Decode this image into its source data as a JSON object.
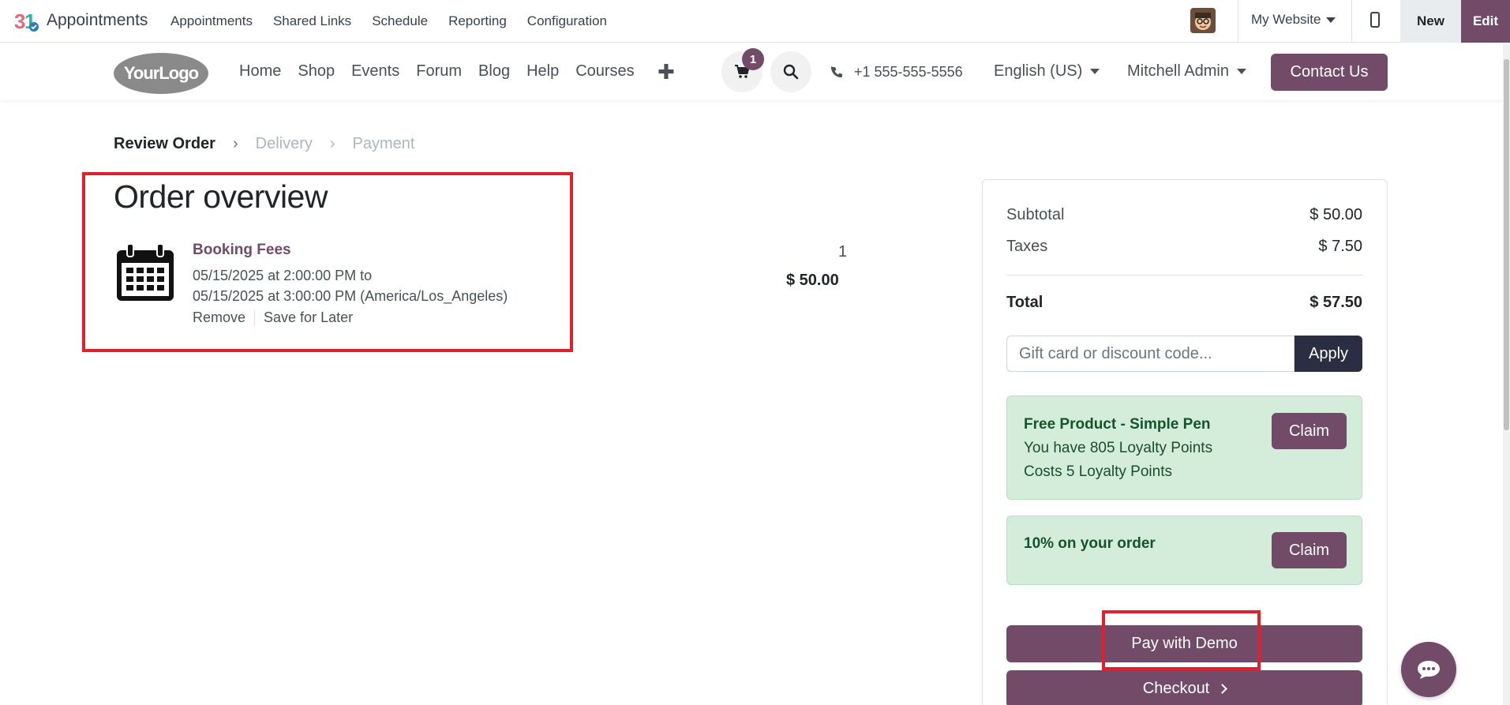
{
  "adminbar": {
    "app_title": "Appointments",
    "menu": [
      "Appointments",
      "Shared Links",
      "Schedule",
      "Reporting",
      "Configuration"
    ],
    "website_selector": "My Website",
    "new_label": "New",
    "edit_label": "Edit"
  },
  "sitenav": {
    "logo_text": "YourLogo",
    "links": [
      "Home",
      "Shop",
      "Events",
      "Forum",
      "Blog",
      "Help",
      "Courses"
    ],
    "cart_count": "1",
    "phone": "+1 555-555-5556",
    "language": "English (US)",
    "user": "Mitchell Admin",
    "contact_label": "Contact Us"
  },
  "breadcrumb": {
    "steps": [
      "Review Order",
      "Delivery",
      "Payment"
    ]
  },
  "order": {
    "title": "Order overview",
    "product_name": "Booking Fees",
    "desc_line1": "05/15/2025 at 2:00:00 PM to",
    "desc_line2": "05/15/2025 at 3:00:00 PM (America/Los_Angeles)",
    "remove_label": "Remove",
    "save_later_label": "Save for Later",
    "quantity": "1",
    "price": "$ 50.00"
  },
  "summary": {
    "subtotal_label": "Subtotal",
    "subtotal_value": "$ 50.00",
    "taxes_label": "Taxes",
    "taxes_value": "$ 7.50",
    "total_label": "Total",
    "total_value": "$ 57.50",
    "promo_placeholder": "Gift card or discount code...",
    "apply_label": "Apply",
    "rewards": [
      {
        "title": "Free Product - Simple Pen",
        "line1": "You have 805 Loyalty Points",
        "line2": "Costs 5 Loyalty Points",
        "claim": "Claim"
      },
      {
        "title": "10% on your order",
        "claim": "Claim"
      }
    ],
    "pay_label": "Pay with Demo",
    "checkout_label": "Checkout"
  },
  "colors": {
    "brand": "#714b67",
    "highlight": "#e0202d",
    "reward_bg": "#d4edda"
  }
}
